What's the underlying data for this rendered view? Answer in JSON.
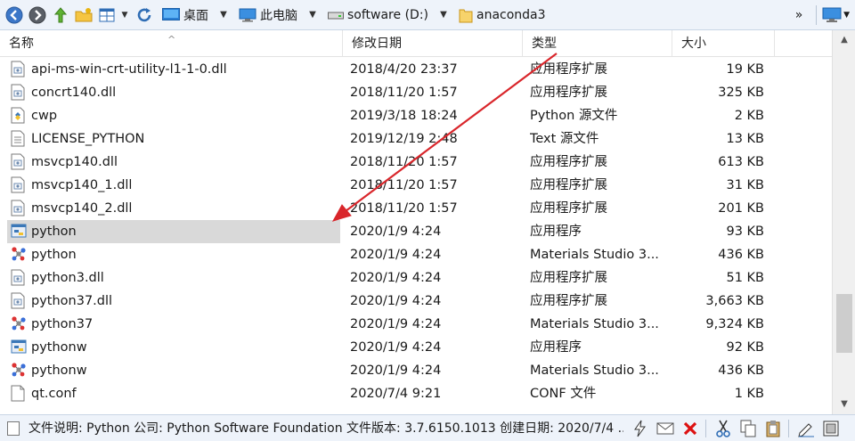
{
  "toolbar": {
    "breadcrumbs": [
      {
        "label": "桌面",
        "icon": "desktop-icon"
      },
      {
        "label": "此电脑",
        "icon": "computer-icon"
      },
      {
        "label": "software (D:)",
        "icon": "drive-icon"
      },
      {
        "label": "anaconda3",
        "icon": "folder-icon"
      }
    ],
    "overflow_label": "»"
  },
  "columns": {
    "name": "名称",
    "date": "修改日期",
    "type": "类型",
    "size": "大小"
  },
  "files": [
    {
      "name": "api-ms-win-crt-utility-l1-1-0.dll",
      "date": "2018/4/20 23:37",
      "type": "应用程序扩展",
      "size": "19 KB",
      "icon": "dll-icon"
    },
    {
      "name": "concrt140.dll",
      "date": "2018/11/20 1:57",
      "type": "应用程序扩展",
      "size": "325 KB",
      "icon": "dll-icon"
    },
    {
      "name": "cwp",
      "date": "2019/3/18 18:24",
      "type": "Python 源文件",
      "size": "2 KB",
      "icon": "python-source-icon"
    },
    {
      "name": "LICENSE_PYTHON",
      "date": "2019/12/19 2:48",
      "type": "Text 源文件",
      "size": "13 KB",
      "icon": "text-file-icon"
    },
    {
      "name": "msvcp140.dll",
      "date": "2018/11/20 1:57",
      "type": "应用程序扩展",
      "size": "613 KB",
      "icon": "dll-icon"
    },
    {
      "name": "msvcp140_1.dll",
      "date": "2018/11/20 1:57",
      "type": "应用程序扩展",
      "size": "31 KB",
      "icon": "dll-icon"
    },
    {
      "name": "msvcp140_2.dll",
      "date": "2018/11/20 1:57",
      "type": "应用程序扩展",
      "size": "201 KB",
      "icon": "dll-icon"
    },
    {
      "name": "python",
      "date": "2020/1/9 4:24",
      "type": "应用程序",
      "size": "93 KB",
      "icon": "python-exe-icon",
      "selected": true
    },
    {
      "name": "python",
      "date": "2020/1/9 4:24",
      "type": "Materials Studio 3...",
      "size": "436 KB",
      "icon": "molecule-icon"
    },
    {
      "name": "python3.dll",
      "date": "2020/1/9 4:24",
      "type": "应用程序扩展",
      "size": "51 KB",
      "icon": "dll-icon"
    },
    {
      "name": "python37.dll",
      "date": "2020/1/9 4:24",
      "type": "应用程序扩展",
      "size": "3,663 KB",
      "icon": "dll-icon"
    },
    {
      "name": "python37",
      "date": "2020/1/9 4:24",
      "type": "Materials Studio 3...",
      "size": "9,324 KB",
      "icon": "molecule-icon"
    },
    {
      "name": "pythonw",
      "date": "2020/1/9 4:24",
      "type": "应用程序",
      "size": "92 KB",
      "icon": "python-exe-icon"
    },
    {
      "name": "pythonw",
      "date": "2020/1/9 4:24",
      "type": "Materials Studio 3...",
      "size": "436 KB",
      "icon": "molecule-icon"
    },
    {
      "name": "qt.conf",
      "date": "2020/7/4 9:21",
      "type": "CONF 文件",
      "size": "1 KB",
      "icon": "file-icon"
    }
  ],
  "status": {
    "text": "文件说明: Python 公司: Python Software Foundation 文件版本: 3.7.6150.1013 创建日期: 2020/7/4 ..."
  },
  "colors": {
    "selection": "#d9d9d9",
    "toolbar_bg": "#eef3fa",
    "arrow": "#d9262b"
  }
}
